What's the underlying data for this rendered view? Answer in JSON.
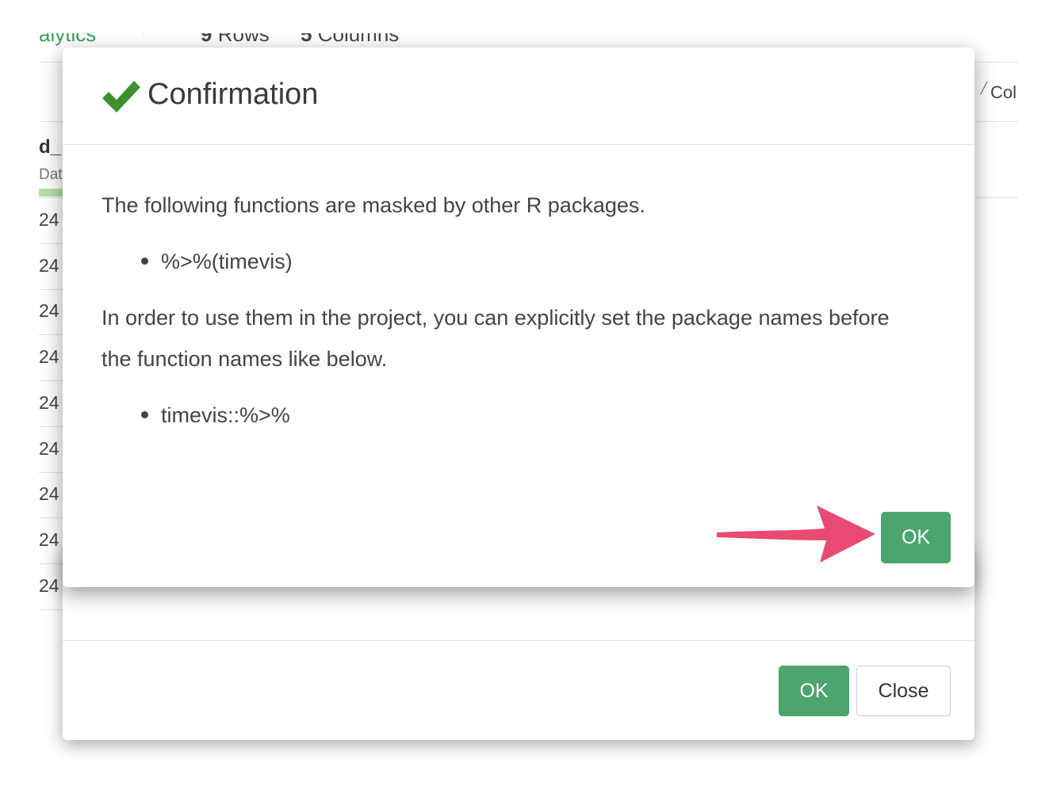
{
  "background": {
    "analytics_fragment": "alytics",
    "rows_count": "9",
    "rows_label": "Rows",
    "cols_count": "5",
    "cols_label": "Columns",
    "col_fragment": "Col",
    "column_header": "d_",
    "column_type": "Dat",
    "row_values": [
      "24",
      "24",
      "24",
      "24",
      "24",
      "24",
      "24",
      "24",
      "24"
    ]
  },
  "confirm_dialog": {
    "title": "Confirmation",
    "icon": "check-icon",
    "message": "The following functions are masked by other R packages.",
    "masked_functions": [
      "%>%(timevis)"
    ],
    "instruction": "In order to use them in the project, you can explicitly set the package names before the function names like below.",
    "examples": [
      "timevis::%>%"
    ],
    "ok_label": "OK"
  },
  "under_dialog": {
    "ok_label": "OK",
    "close_label": "Close"
  },
  "colors": {
    "accent_green": "#4ca46e",
    "check_green": "#3f8f2f",
    "annotation_arrow": "#e84a72"
  }
}
